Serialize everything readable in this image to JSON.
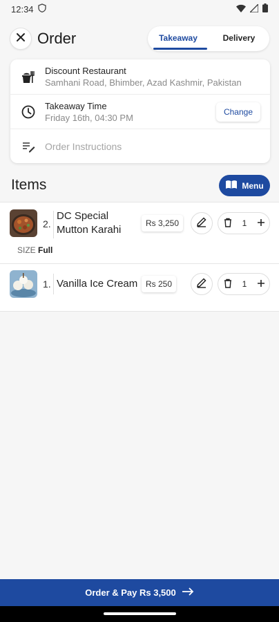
{
  "status_bar": {
    "time": "12:34"
  },
  "header": {
    "title": "Order",
    "tabs": [
      {
        "label": "Takeaway"
      },
      {
        "label": "Delivery"
      }
    ]
  },
  "restaurant": {
    "name": "Discount Restaurant",
    "address": "Samhani Road, Bhimber, Azad Kashmir, Pakistan"
  },
  "takeaway": {
    "label": "Takeaway Time",
    "time": "Friday 16th, 04:30 PM",
    "change_label": "Change"
  },
  "instructions": {
    "placeholder": "Order Instructions"
  },
  "items_section": {
    "title": "Items",
    "menu_label": "Menu"
  },
  "items": [
    {
      "index": "2.",
      "name_line1": "DC Special",
      "name_line2": "Mutton Karahi",
      "price": "Rs 3,250",
      "quantity": "1",
      "size_label": "SIZE",
      "size_value": "Full"
    },
    {
      "index": "1.",
      "name": "Vanilla Ice Cream",
      "price": "Rs 250",
      "quantity": "1"
    }
  ],
  "footer": {
    "order_label": "Order & Pay Rs 3,500"
  },
  "colors": {
    "accent": "#1e4aa0"
  }
}
